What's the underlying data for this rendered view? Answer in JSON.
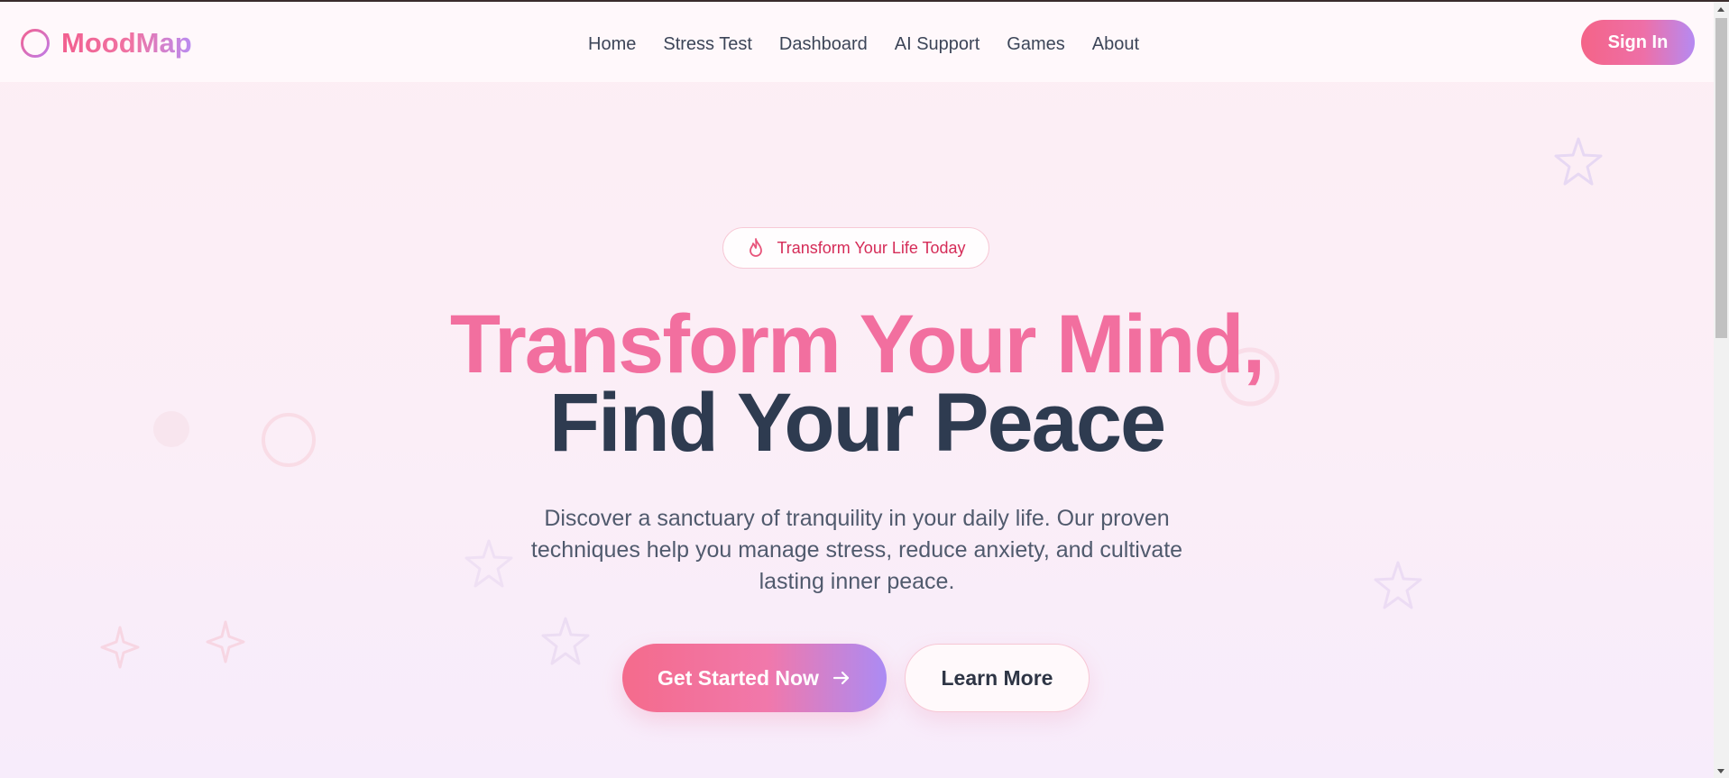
{
  "brand": {
    "name": "MoodMap",
    "icon": "alert-circle-icon"
  },
  "nav": {
    "links": [
      "Home",
      "Stress Test",
      "Dashboard",
      "AI Support",
      "Games",
      "About"
    ],
    "signin_label": "Sign In"
  },
  "hero": {
    "badge_icon": "flame-icon",
    "badge_text": "Transform Your Life Today",
    "headline_line1": "Transform Your Mind,",
    "headline_line2": "Find Your Peace",
    "subtitle_lines": [
      "Discover a sanctuary of tranquility in your daily life. Our proven",
      "techniques help you manage stress, reduce anxiety, and cultivate",
      "lasting inner peace."
    ],
    "primary_button": "Get Started Now",
    "primary_button_icon": "arrow-right-icon",
    "secondary_button": "Learn More"
  },
  "colors": {
    "brand_pink": "#f26f9f",
    "brand_purple": "#b58af2",
    "headline_dark": "#2e3b50",
    "badge_text": "#d52c58"
  }
}
